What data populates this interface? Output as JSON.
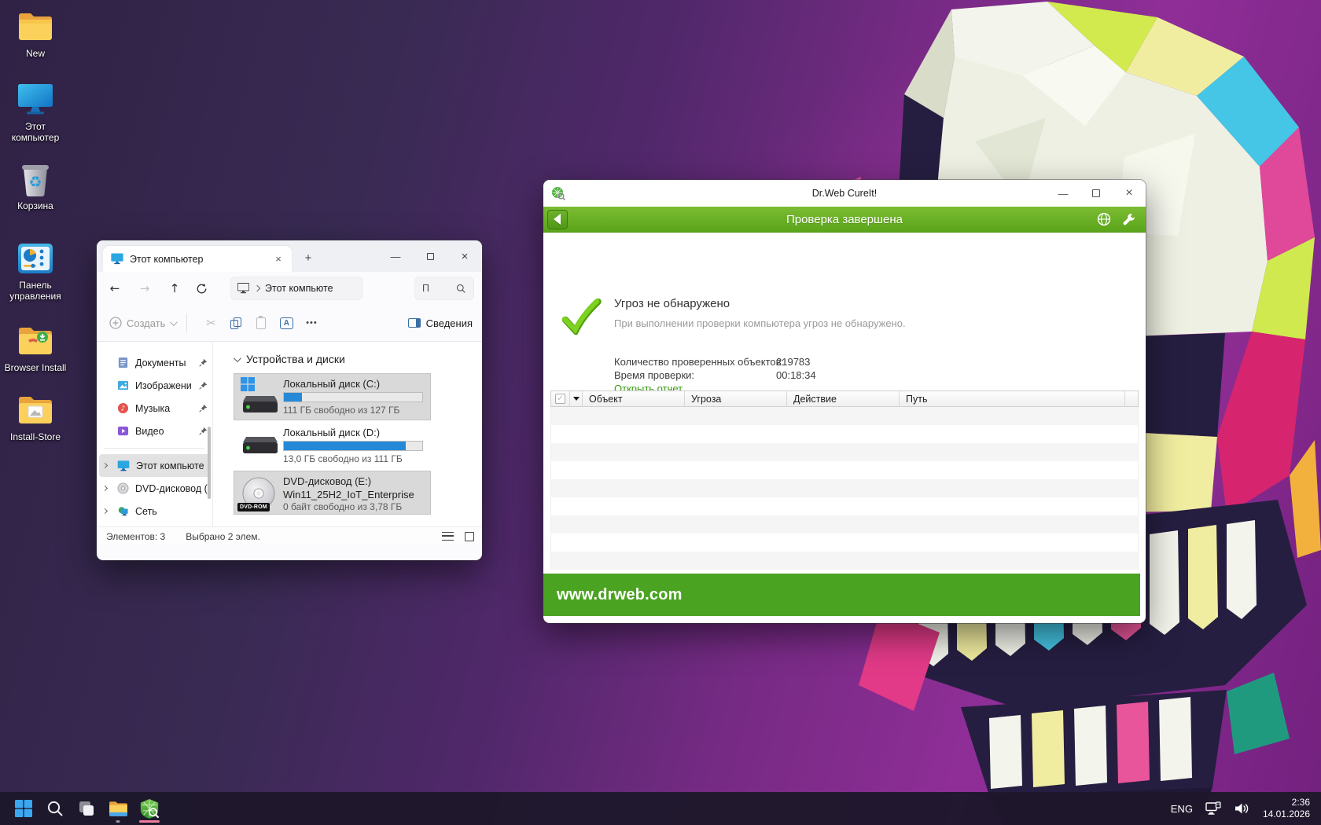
{
  "desktop_icons": [
    {
      "label": "New"
    },
    {
      "label": "Этот компьютер"
    },
    {
      "label": "Корзина"
    },
    {
      "label": "Панель управления"
    },
    {
      "label": "Browser Install"
    },
    {
      "label": "Install-Store"
    }
  ],
  "explorer": {
    "tab_title": "Этот компьютер",
    "breadcrumb_root": "Этот компьюте",
    "search_placeholder": "П",
    "toolbar": {
      "create_label": "Создать",
      "details_label": "Сведения"
    },
    "sidebar": {
      "pinned": [
        {
          "label": "Документы"
        },
        {
          "label": "Изображени"
        },
        {
          "label": "Музыка"
        },
        {
          "label": "Видео"
        }
      ],
      "tree": [
        {
          "label": "Этот компьюте"
        },
        {
          "label": "DVD-дисковод ("
        },
        {
          "label": "Сеть"
        }
      ]
    },
    "section_title": "Устройства и диски",
    "drives": [
      {
        "name": "Локальный диск (C:)",
        "caption": "111 ГБ свободно из 127 ГБ",
        "fill_percent": 13
      },
      {
        "name": "Локальный диск (D:)",
        "caption": "13,0 ГБ свободно из 111 ГБ",
        "fill_percent": 88
      },
      {
        "name": "DVD-дисковод (E:)",
        "line2": "Win11_25H2_IoT_Enterprise",
        "caption": "0 байт свободно из 3,78 ГБ",
        "badge": "DVD-ROM"
      }
    ],
    "status": {
      "items": "Элементов: 3",
      "selected": "Выбрано 2 элем."
    }
  },
  "drweb": {
    "title": "Dr.Web CureIt!",
    "status_header": "Проверка завершена",
    "result_title": "Угроз не обнаружено",
    "result_subtitle": "При выполнении проверки компьютера угроз не обнаружено.",
    "stat1_label": "Количество проверенных объектов:",
    "stat1_value": "219783",
    "stat2_label": "Время проверки:",
    "stat2_value": "00:18:34",
    "report_link": "Открыть отчет",
    "columns": [
      "Объект",
      "Угроза",
      "Действие",
      "Путь"
    ],
    "footer_url": "www.drweb.com"
  },
  "taskbar": {
    "lang": "ENG",
    "time": "2:36",
    "date": "14.01.2026"
  },
  "colors": {
    "drweb_header_green": "#69b02c",
    "drweb_footer_green": "#4aa321",
    "drweb_link_green": "#3c9a10",
    "progress_blue": "#2589d8",
    "selection_gray": "#d9d9d9",
    "taskbar_indicator_pink": "#ee7f9a"
  },
  "icons": {
    "close": "×",
    "minimize": "—",
    "new_tab": "+",
    "cut": "✂",
    "more": "•••",
    "rename_letter": "A",
    "music_note": "♪",
    "recycle": "♻",
    "check": "✓",
    "back_arrow": "←",
    "forward_arrow": "→",
    "up_arrow": "↑"
  }
}
